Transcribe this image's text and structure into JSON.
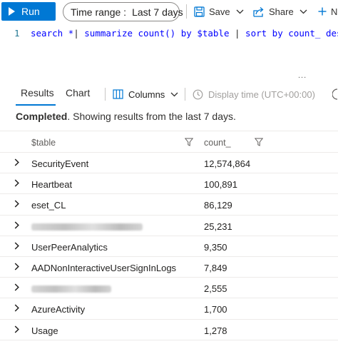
{
  "toolbar": {
    "run_label": "Run",
    "time_range_label": "Time range :",
    "time_range_value": "Last 7 days",
    "save_label": "Save",
    "share_label": "Share",
    "new_label": "N"
  },
  "editor": {
    "line_number": "1",
    "query": "search *| summarize count() by $table | sort by count_ desc",
    "overflow_dots": "..."
  },
  "results": {
    "tabs": [
      {
        "label": "Results",
        "active": true
      },
      {
        "label": "Chart",
        "active": false
      }
    ],
    "columns_label": "Columns",
    "display_time_label": "Display time (UTC+00:00)",
    "status_strong": "Completed",
    "status_text": ". Showing results from the last 7 days."
  },
  "table": {
    "headers": [
      "$table",
      "count_"
    ],
    "rows": [
      {
        "table": "SecurityEvent",
        "count": "12,574,864",
        "redacted": false
      },
      {
        "table": "Heartbeat",
        "count": "100,891",
        "redacted": false
      },
      {
        "table": "eset_CL",
        "count": "86,129",
        "redacted": false
      },
      {
        "table": "",
        "count": "25,231",
        "redacted": true
      },
      {
        "table": "UserPeerAnalytics",
        "count": "9,350",
        "redacted": false
      },
      {
        "table": "AADNonInteractiveUserSignInLogs",
        "count": "7,849",
        "redacted": false
      },
      {
        "table": "",
        "count": "2,555",
        "redacted": true
      },
      {
        "table": "AzureActivity",
        "count": "1,700",
        "redacted": false
      },
      {
        "table": "Usage",
        "count": "1,278",
        "redacted": false
      }
    ]
  },
  "colors": {
    "accent": "#0078d4",
    "keyword": "#0000ff",
    "line_number": "#237893"
  },
  "icons": {
    "run": "play-icon",
    "save": "save-icon",
    "share": "share-icon",
    "new": "plus-icon",
    "columns": "columns-icon",
    "display_time": "clock-icon",
    "filter": "filter-icon",
    "expand": "chevron-right-icon"
  }
}
